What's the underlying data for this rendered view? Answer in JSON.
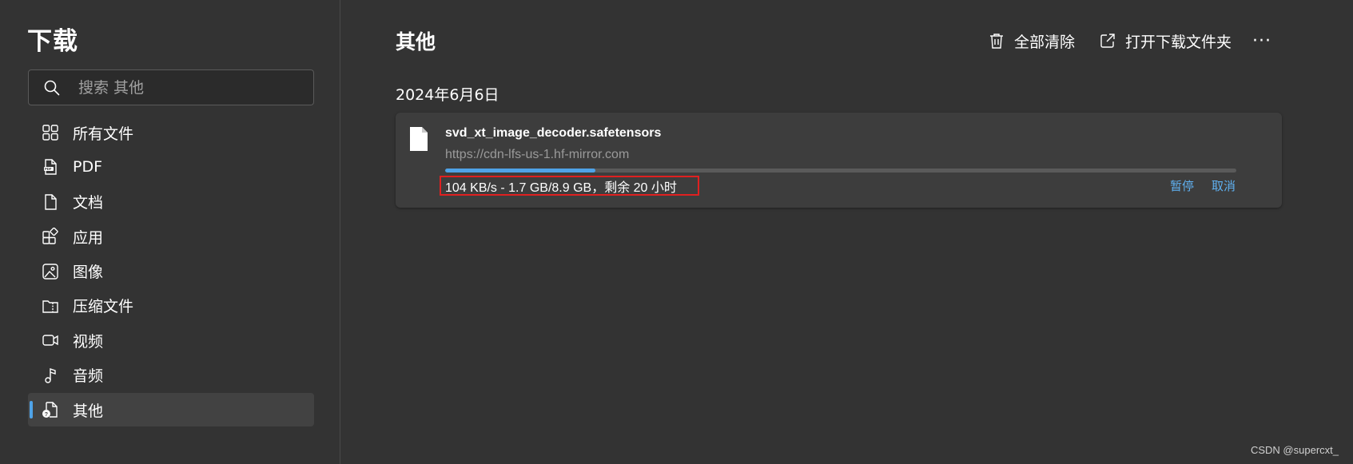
{
  "sidebar": {
    "title": "下载",
    "search": {
      "placeholder": "搜索 其他",
      "value": ""
    },
    "items": [
      {
        "label": "所有文件",
        "icon": "grid-icon"
      },
      {
        "label": "PDF",
        "icon": "pdf-file-icon"
      },
      {
        "label": "文档",
        "icon": "document-icon"
      },
      {
        "label": "应用",
        "icon": "apps-icon"
      },
      {
        "label": "图像",
        "icon": "image-icon"
      },
      {
        "label": "压缩文件",
        "icon": "archive-icon"
      },
      {
        "label": "视频",
        "icon": "video-icon"
      },
      {
        "label": "音频",
        "icon": "music-note-icon"
      },
      {
        "label": "其他",
        "icon": "unknown-file-icon",
        "active": true
      }
    ]
  },
  "main": {
    "title": "其他",
    "toolbar": {
      "clear_all": "全部清除",
      "open_folder": "打开下载文件夹",
      "more": "···"
    },
    "date_heading": "2024年6月6日",
    "download": {
      "file_name": "svd_xt_image_decoder.safetensors",
      "url": "https://cdn-lfs-us-1.hf-mirror.com",
      "status": "104 KB/s - 1.7 GB/8.9 GB，剩余 20 小时",
      "progress_fraction": 0.19,
      "pause_label": "暂停",
      "cancel_label": "取消"
    }
  },
  "watermark": "CSDN @supercxt_",
  "colors": {
    "background": "#333333",
    "card": "#3d3d3d",
    "accent": "#4fa3e8",
    "link": "#5fb0f0",
    "highlight": "#e02020"
  }
}
